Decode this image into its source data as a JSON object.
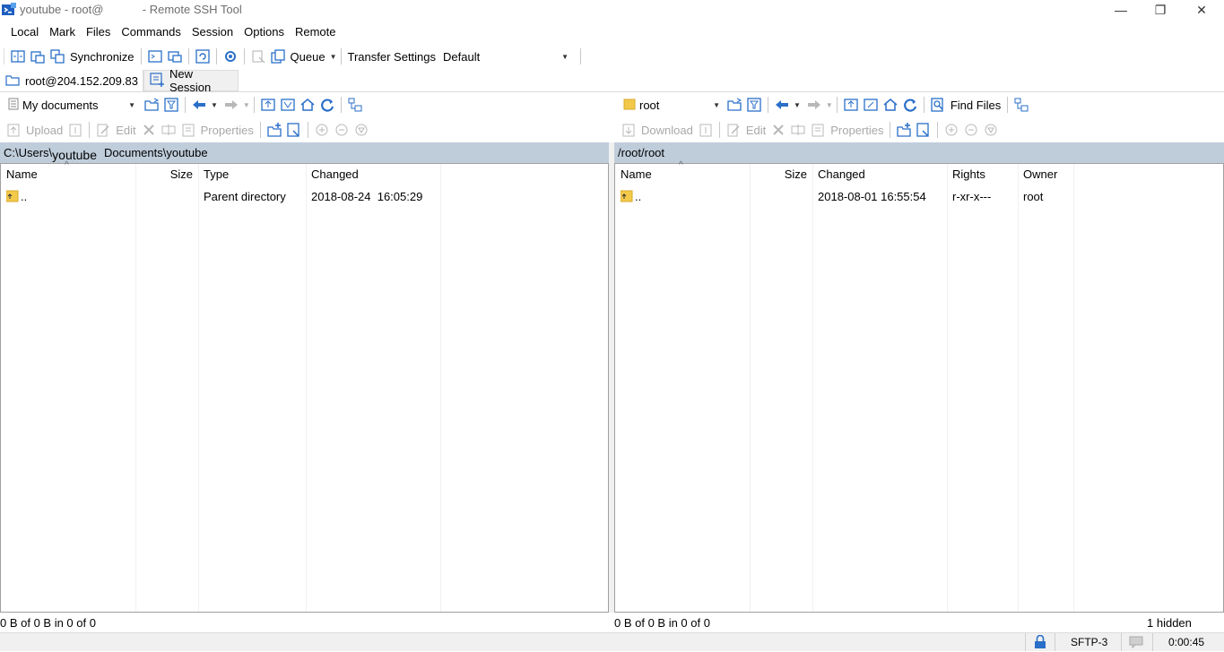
{
  "window": {
    "title": "youtube - root@            - Remote SSH Tool",
    "minimize_glyph": "—",
    "restore_glyph": "❐",
    "close_glyph": "✕"
  },
  "menu": [
    "Local",
    "Mark",
    "Files",
    "Commands",
    "Session",
    "Options",
    "Remote"
  ],
  "toolbar": {
    "synchronize": "Synchronize",
    "queue": "Queue",
    "transfer_settings_label": "Transfer Settings",
    "transfer_settings_value": "Default"
  },
  "tabs": {
    "session": "root@204.152.209.83",
    "new_session": "New Session"
  },
  "local": {
    "location": "My documents",
    "upload": "Upload",
    "edit": "Edit",
    "properties": "Properties",
    "path_prefix": "C:\\Users\\",
    "path_user": "youtube",
    "path_suffix": "Documents\\youtube",
    "columns": [
      "Name",
      "Size",
      "Type",
      "Changed"
    ],
    "rows": [
      {
        "name": "..",
        "size": "",
        "type": "Parent directory",
        "changed": "2018-08-24  16:05:29"
      }
    ],
    "status": "0 B of 0 B in 0 of 0"
  },
  "remote": {
    "location": "root",
    "find_files": "Find Files",
    "download": "Download",
    "edit": "Edit",
    "properties": "Properties",
    "path": "/root/root",
    "columns": [
      "Name",
      "Size",
      "Changed",
      "Rights",
      "Owner"
    ],
    "rows": [
      {
        "name": "..",
        "size": "",
        "changed": "2018-08-01 16:55:54",
        "rights": "r-xr-x---",
        "owner": "root"
      }
    ],
    "status": "0 B of 0 B in 0 of 0",
    "hidden": "1 hidden"
  },
  "bottom": {
    "protocol": "SFTP-3",
    "elapsed": "0:00:45"
  },
  "colors": {
    "pathbar": "#bfcddb",
    "icon_blue": "#2a6fc9",
    "folder_yellow": "#f3c94a"
  }
}
